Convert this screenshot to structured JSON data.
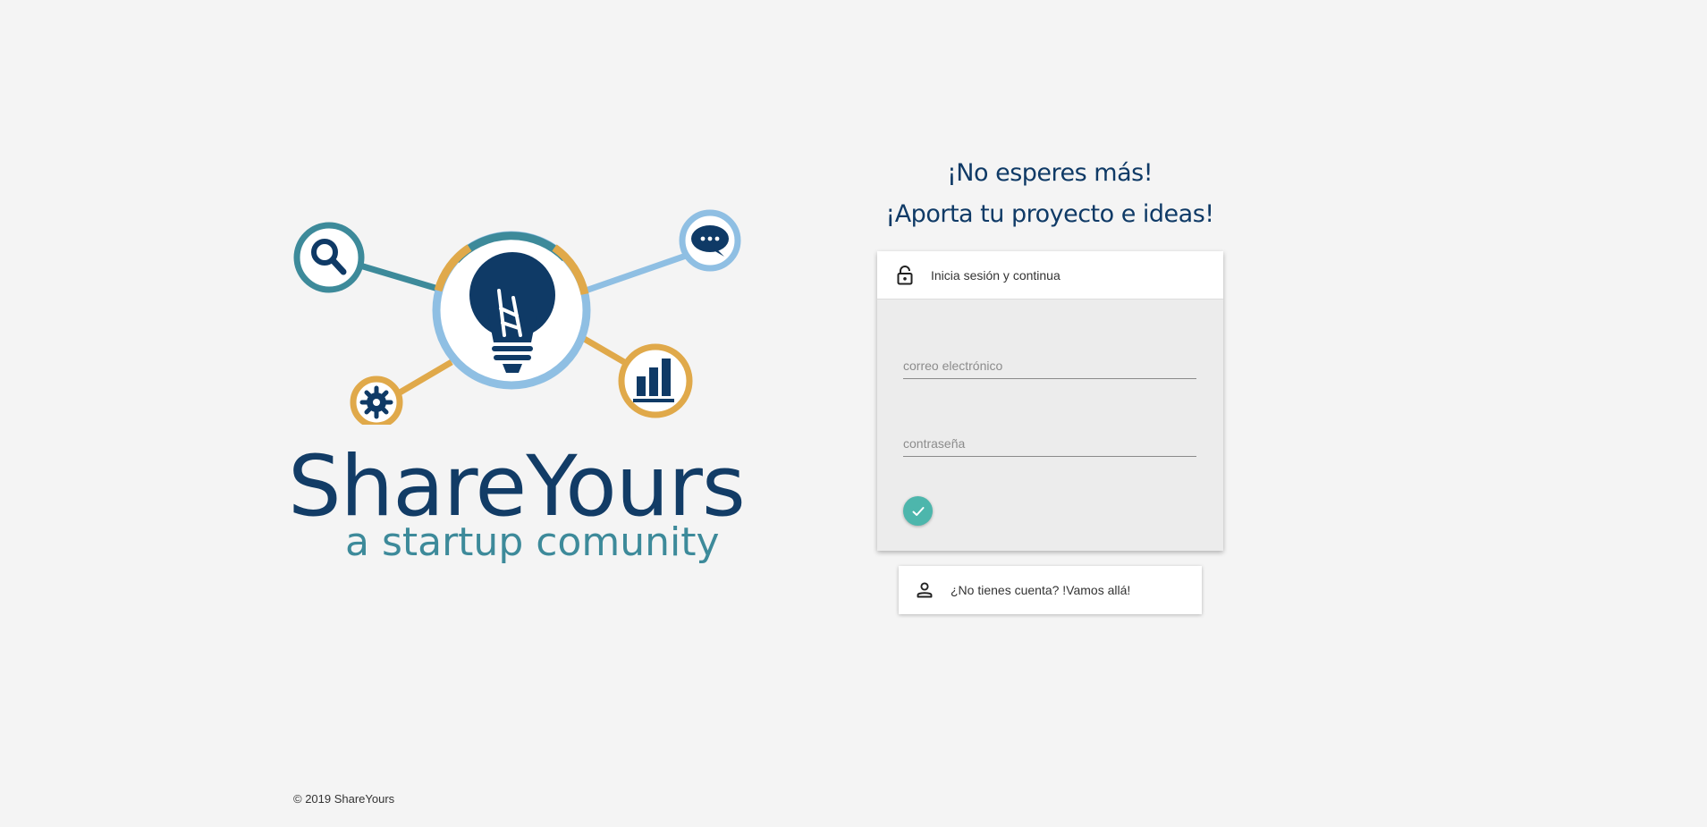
{
  "brand": {
    "name": "ShareYours",
    "tagline": "a startup comunity",
    "colors": {
      "navy": "#0f3a66",
      "teal": "#3d8a9a",
      "gold": "#e0a94a",
      "light_blue": "#8fbfe3",
      "accent_button": "#4db6ac"
    }
  },
  "headline": {
    "line1": "¡No esperes más!",
    "line2": "¡Aporta tu proyecto e ideas!"
  },
  "login": {
    "header_icon": "lock-icon",
    "header_text": "Inicia sesión y continua",
    "email_placeholder": "correo electrónico",
    "password_placeholder": "contraseña",
    "submit_icon": "check-icon"
  },
  "signup": {
    "icon": "person-icon",
    "text": "¿No tienes cuenta? !Vamos allá!"
  },
  "footer": {
    "copyright": "© 2019 ShareYours"
  }
}
